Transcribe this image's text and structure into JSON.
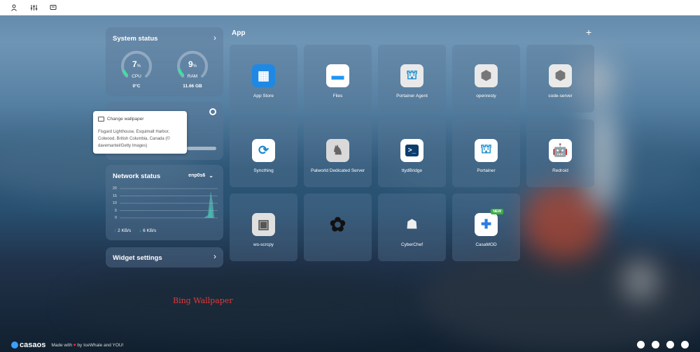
{
  "topbar": {
    "icons": [
      "user-icon",
      "sliders-icon",
      "messages-icon"
    ]
  },
  "system_status": {
    "title": "System status",
    "cpu": {
      "value": "7",
      "unit": "%",
      "label": "CPU",
      "sub": "0°C",
      "percent": 7
    },
    "ram": {
      "value": "9",
      "unit": "%",
      "label": "RAM",
      "sub": "11.66 GB",
      "percent": 9
    }
  },
  "wallpaper_tooltip": {
    "title": "Change wallpaper",
    "caption": "Fisgard Lighthouse, Esquimalt Harbor, Colwood, British Columbia, Canada (© davemantel/Getty Images)"
  },
  "network_status": {
    "title": "Network status",
    "interface": "enp0s6",
    "y_ticks": [
      "20",
      "15",
      "10",
      "5",
      "0"
    ],
    "upload": "2 KB/s",
    "download": "6 KB/s"
  },
  "widget_settings": {
    "label": "Widget settings"
  },
  "apps_section": {
    "title": "App",
    "add": "+"
  },
  "apps": [
    {
      "label": "App Store",
      "icon": "app-store-icon",
      "color": "#1e88e5"
    },
    {
      "label": "Files",
      "icon": "folder-icon",
      "color": "#ffffff"
    },
    {
      "label": "Portainer Agent",
      "icon": "portainer-icon",
      "color": "#e9e9e9"
    },
    {
      "label": "openresty",
      "icon": "box-icon",
      "color": "#e9e9e9"
    },
    {
      "label": "code-server",
      "icon": "box-icon",
      "color": "#e9e9e9"
    },
    {
      "label": "Syncthing",
      "icon": "syncthing-icon",
      "color": "#ffffff"
    },
    {
      "label": "Palworld Dedicated Server",
      "icon": "palworld-icon",
      "color": "#d9d9d9"
    },
    {
      "label": "ttydBridge",
      "icon": "terminal-icon",
      "color": "#ffffff"
    },
    {
      "label": "Portainer",
      "icon": "portainer-icon",
      "color": "#ffffff"
    },
    {
      "label": "Redroid",
      "icon": "android-icon",
      "color": "#ffffff"
    },
    {
      "label": "ws-scrcpy",
      "icon": "android-robot-icon",
      "color": "#e0e0e0"
    },
    {
      "label": "",
      "icon": "openai-icon",
      "color": "transparent"
    },
    {
      "label": "CyberChef",
      "icon": "chef-icon",
      "color": "transparent"
    },
    {
      "label": "CasaMOD",
      "icon": "puzzle-icon",
      "color": "#ffffff",
      "badge": "NEW"
    }
  ],
  "watermark": "Bing Wallpaper",
  "footer": {
    "brand": "casaos",
    "made_with": "Made with",
    "by": "by IceWhale and YOU!"
  }
}
